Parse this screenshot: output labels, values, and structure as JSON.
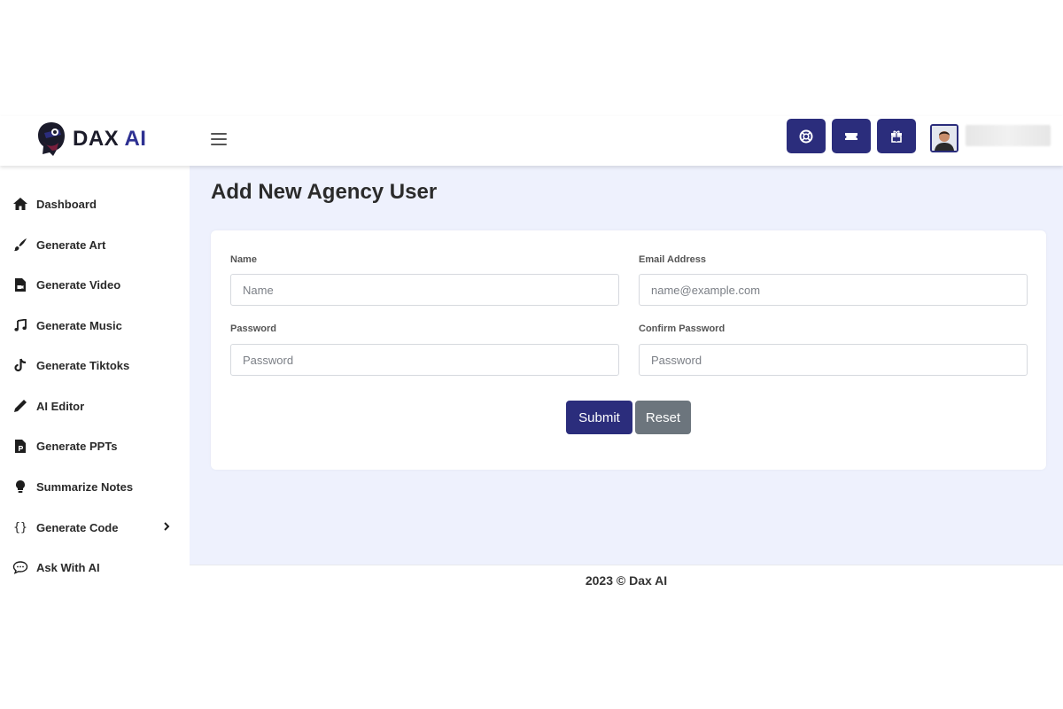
{
  "brand": {
    "name": "DAX",
    "name_accent": "AI"
  },
  "header": {
    "buttons": [
      {
        "icon": "lifebuoy-icon"
      },
      {
        "icon": "ticket-icon"
      },
      {
        "icon": "gift-icon"
      }
    ]
  },
  "sidebar": {
    "items": [
      {
        "label": "Dashboard",
        "icon": "home-icon"
      },
      {
        "label": "Generate Art",
        "icon": "brush-icon"
      },
      {
        "label": "Generate Video",
        "icon": "video-file-icon"
      },
      {
        "label": "Generate Music",
        "icon": "music-note-icon"
      },
      {
        "label": "Generate Tiktoks",
        "icon": "tiktok-icon"
      },
      {
        "label": "AI Editor",
        "icon": "pen-icon"
      },
      {
        "label": "Generate PPTs",
        "icon": "ppt-file-icon"
      },
      {
        "label": "Summarize Notes",
        "icon": "lightbulb-icon"
      },
      {
        "label": "Generate Code",
        "icon": "code-braces-icon",
        "has_submenu": true
      },
      {
        "label": "Ask With AI",
        "icon": "chat-bubble-icon"
      }
    ]
  },
  "main": {
    "title": "Add New Agency User",
    "form": {
      "name": {
        "label": "Name",
        "placeholder": "Name",
        "value": ""
      },
      "email": {
        "label": "Email Address",
        "placeholder": "name@example.com",
        "value": ""
      },
      "password": {
        "label": "Password",
        "placeholder": "Password",
        "value": ""
      },
      "confirm_password": {
        "label": "Confirm Password",
        "placeholder": "Password",
        "value": ""
      },
      "submit_label": "Submit",
      "reset_label": "Reset"
    }
  },
  "footer": {
    "text": "2023 © Dax AI"
  },
  "colors": {
    "primary": "#2b2d7c",
    "secondary": "#6c757d",
    "content_bg": "#eef1fd"
  }
}
